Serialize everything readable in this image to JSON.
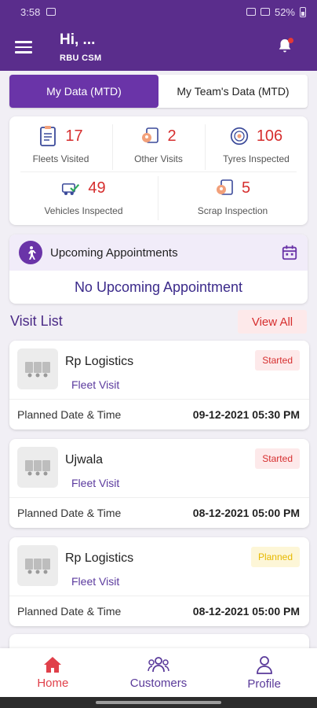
{
  "status_bar": {
    "time": "3:58",
    "battery": "52%"
  },
  "header": {
    "greeting": "Hi, ...",
    "role": "RBU CSM"
  },
  "toggle": {
    "tabs": [
      {
        "label": "My Data (MTD)",
        "active": true
      },
      {
        "label": "My Team's Data (MTD)",
        "active": false
      }
    ]
  },
  "stats": [
    {
      "value": "17",
      "label": "Fleets Visited",
      "icon": "clipboard-icon"
    },
    {
      "value": "2",
      "label": "Other Visits",
      "icon": "location-document-icon"
    },
    {
      "value": "106",
      "label": "Tyres Inspected",
      "icon": "tyre-icon"
    },
    {
      "value": "49",
      "label": "Vehicles Inspected",
      "icon": "vehicle-check-icon"
    },
    {
      "value": "5",
      "label": "Scrap Inspection",
      "icon": "scrap-location-icon"
    }
  ],
  "appointments": {
    "title": "Upcoming Appointments",
    "empty_text": "No Upcoming Appointment"
  },
  "visit_list": {
    "title": "Visit List",
    "view_all": "View All",
    "planned_label": "Planned Date & Time",
    "items": [
      {
        "name": "Rp Logistics",
        "type": "Fleet Visit",
        "status": "Started",
        "datetime": "09-12-2021 05:30 PM"
      },
      {
        "name": "Ujwala",
        "type": "Fleet Visit",
        "status": "Started",
        "datetime": "08-12-2021 05:00 PM"
      },
      {
        "name": "Rp Logistics",
        "type": "Fleet Visit",
        "status": "Planned",
        "datetime": "08-12-2021 05:00 PM"
      }
    ]
  },
  "bottom_nav": [
    {
      "label": "Home",
      "icon": "home-icon",
      "active": true
    },
    {
      "label": "Customers",
      "icon": "customers-icon",
      "active": false
    },
    {
      "label": "Profile",
      "icon": "profile-icon",
      "active": false
    }
  ],
  "colors": {
    "primary": "#5a2d8c",
    "accent": "#d62e2e",
    "planned": "#e6b800"
  }
}
